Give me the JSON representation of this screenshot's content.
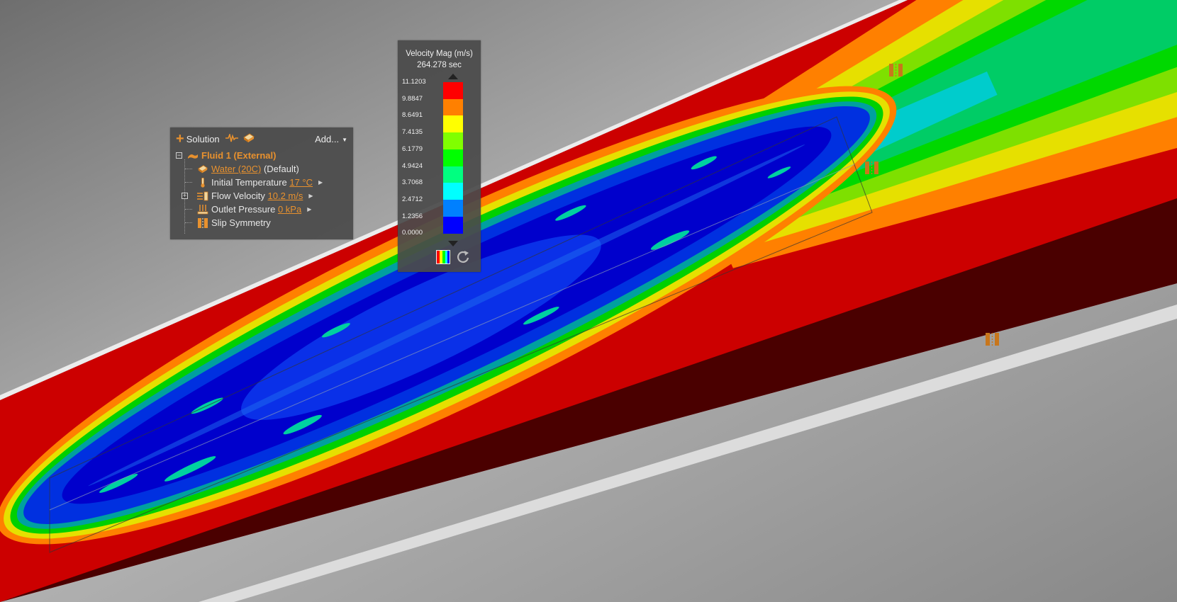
{
  "solution_panel": {
    "solution_label": "Solution",
    "add_label": "Add...",
    "fluid_label": "Fluid 1 (External)",
    "material_link": "Water (20C)",
    "material_suffix": "(Default)",
    "initial_temperature_label": "Initial Temperature",
    "initial_temperature_value": "17 °C",
    "flow_velocity_label": "Flow Velocity",
    "flow_velocity_value": "10.2 m/s",
    "outlet_pressure_label": "Outlet Pressure",
    "outlet_pressure_value": "0 kPa",
    "slip_symmetry_label": "Slip Symmetry"
  },
  "legend": {
    "title": "Velocity Mag (m/s)",
    "time": "264.278 sec",
    "ticks": [
      "11.1203",
      "9.8847",
      "8.6491",
      "7.4135",
      "6.1779",
      "4.9424",
      "3.7068",
      "2.4712",
      "1.2356",
      "0.0000"
    ],
    "colors": [
      "#ff0000",
      "#ff8000",
      "#ffff00",
      "#80ff00",
      "#00ff00",
      "#00ff80",
      "#00ffff",
      "#0080ff",
      "#0000ff"
    ]
  },
  "accent_color": "#e8912e"
}
